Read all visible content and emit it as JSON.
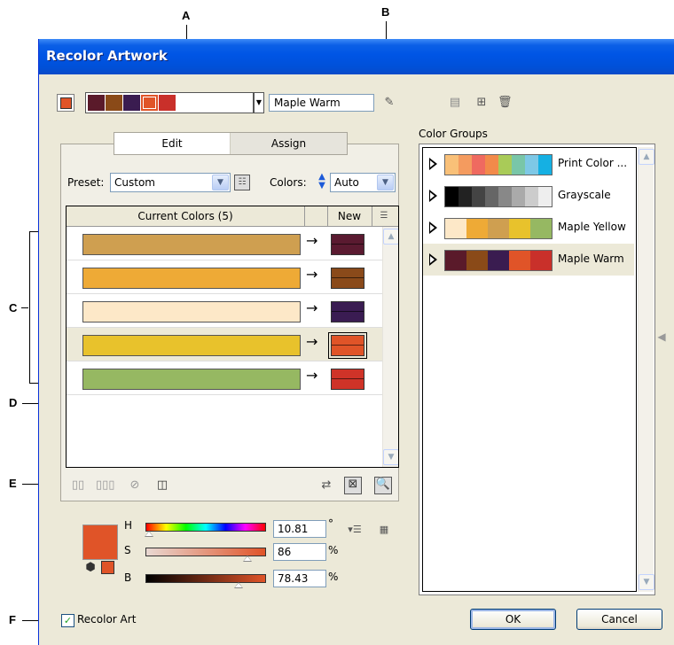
{
  "callouts": {
    "a": "A",
    "b": "B",
    "c": "C",
    "d": "D",
    "e": "E",
    "f": "F"
  },
  "window": {
    "title": "Recolor Artwork"
  },
  "harmony_bar": {
    "swatches": [
      "#5a1a2a",
      "#8a4a18",
      "#3a1c50",
      "#e05428",
      "#c9302a"
    ],
    "group_name": "Maple Warm"
  },
  "tabs": {
    "edit": "Edit",
    "assign": "Assign"
  },
  "preset": {
    "label": "Preset:",
    "value": "Custom"
  },
  "colors": {
    "label": "Colors:",
    "value": "Auto"
  },
  "table": {
    "header_current": "Current Colors (5)",
    "header_new": "New",
    "arrow": "→",
    "rows": [
      {
        "current": "#cf9f50",
        "new": "#5a1a30"
      },
      {
        "current": "#eeaa36",
        "new": "#8a4a1a"
      },
      {
        "current": "#fde8c8",
        "new": "#3a1c52"
      },
      {
        "current": "#e8c22c",
        "new": "#e05428",
        "selected": true
      },
      {
        "current": "#96b862",
        "new": "#cf3328"
      }
    ]
  },
  "color_groups": {
    "title": "Color Groups",
    "groups": [
      {
        "name": "Print Color ...",
        "swatches": [
          "#f9c078",
          "#f49b5f",
          "#ef6a60",
          "#f28a4a",
          "#a9cb58",
          "#79c6a8",
          "#7ec8e6",
          "#15b0e3"
        ]
      },
      {
        "name": "Grayscale",
        "swatches": [
          "#000000",
          "#222222",
          "#444444",
          "#666666",
          "#888888",
          "#aaaaaa",
          "#cccccc",
          "#eeeeee"
        ]
      },
      {
        "name": "Maple Yellow",
        "swatches": [
          "#fde8c8",
          "#eeaa36",
          "#cf9f50",
          "#e8c22c",
          "#96b862"
        ]
      },
      {
        "name": "Maple Warm",
        "swatches": [
          "#5a1a2a",
          "#8a4a18",
          "#3a1c50",
          "#e05428",
          "#c9302a"
        ],
        "selected": true
      }
    ]
  },
  "hsb": {
    "swatch": "#e05428",
    "h": {
      "label": "H",
      "value": "10.81",
      "unit": "°",
      "fraction": 0.03
    },
    "s": {
      "label": "S",
      "value": "86",
      "unit": "%",
      "fraction": 0.86
    },
    "b": {
      "label": "B",
      "value": "78.43",
      "unit": "%",
      "fraction": 0.78
    }
  },
  "recolor_art": {
    "label": "Recolor Art",
    "checked": true
  },
  "buttons": {
    "ok": "OK",
    "cancel": "Cancel"
  }
}
